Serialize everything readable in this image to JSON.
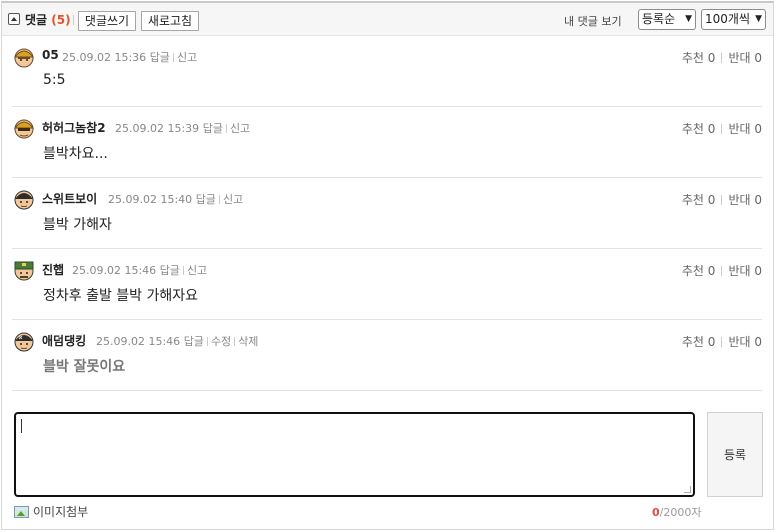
{
  "header": {
    "title": "댓글",
    "count": "(5)",
    "write_label": "댓글쓰기",
    "refresh_label": "새로고침",
    "my_comments_label": "내 댓글 보기",
    "order_select": "등록순",
    "per_page_select": "100개씩"
  },
  "labels": {
    "reply": "답글",
    "report": "신고",
    "edit": "수정",
    "delete": "삭제",
    "upvote": "추천",
    "downvote": "반대"
  },
  "comments": [
    {
      "user": "05",
      "time": "25.09.02 15:36",
      "body": "5:5",
      "up": "0",
      "down": "0",
      "avatar": "yellow-cap-avatar"
    },
    {
      "user": "허허그놈참2",
      "time": "25.09.02 15:39",
      "body": "블박차요...",
      "up": "0",
      "down": "0",
      "avatar": "yellow-cap-avatar"
    },
    {
      "user": "스위트보이",
      "time": "25.09.02 15:40",
      "body": "블박 가해자",
      "up": "0",
      "down": "0",
      "avatar": "dark-cap-avatar"
    },
    {
      "user": "진햅",
      "time": "25.09.02 15:46",
      "body": "정차후 출발 블박 가해자요",
      "up": "0",
      "down": "0",
      "avatar": "green-cap-avatar"
    },
    {
      "user": "애덤댕킹",
      "time": "25.09.02 15:46",
      "body": "블박 잘못이요",
      "up": "0",
      "down": "0",
      "avatar": "dark-cap-avatar"
    }
  ],
  "editor": {
    "submit_label": "등록",
    "attach_label": "이미지첨부",
    "char_current": "0",
    "char_max": "/2000자"
  },
  "colors": {
    "accent_count": "#e0552a",
    "char_count": "#e14a3a"
  }
}
